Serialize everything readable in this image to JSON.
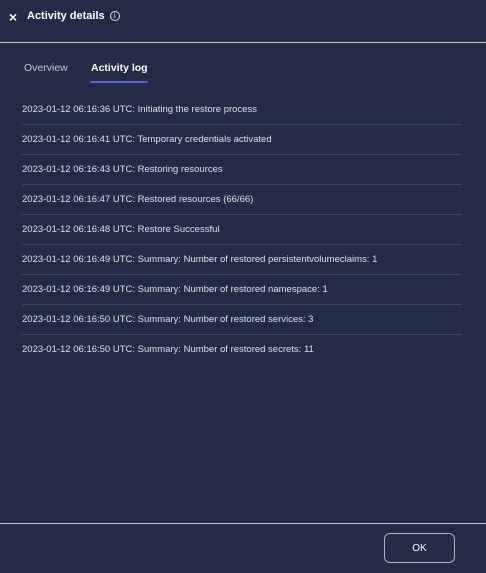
{
  "dialog": {
    "title": "Activity details",
    "close_icon_glyph": "×",
    "info_icon_glyph": "i"
  },
  "tabs": [
    {
      "label": "Overview",
      "active": false
    },
    {
      "label": "Activity log",
      "active": true
    }
  ],
  "activity_log": [
    "2023-01-12 06:16:36 UTC: Initiating the restore process",
    "2023-01-12 06:16:41 UTC: Temporary credentials activated",
    "2023-01-12 06:16:43 UTC: Restoring resources",
    "2023-01-12 06:16:47 UTC: Restored resources (66/66)",
    "2023-01-12 06:16:48 UTC: Restore Successful",
    "2023-01-12 06:16:49 UTC: Summary: Number of restored persistentvolumeclaims: 1",
    "2023-01-12 06:16:49 UTC: Summary: Number of restored namespace: 1",
    "2023-01-12 06:16:50 UTC: Summary: Number of restored services: 3",
    "2023-01-12 06:16:50 UTC: Summary: Number of restored secrets: 11"
  ],
  "footer": {
    "ok_label": "OK"
  },
  "colors": {
    "background": "#232b47",
    "tab_accent": "#5a63d9",
    "divider": "#bfc4d3"
  }
}
